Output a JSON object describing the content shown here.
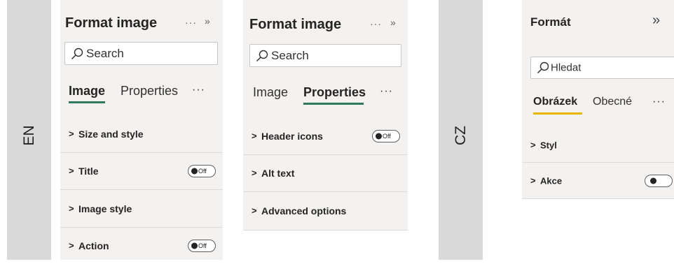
{
  "languages": {
    "en": "EN",
    "cz": "CZ"
  },
  "panel_en_image": {
    "title": "Format image",
    "more_icon": "ellipsis-icon",
    "collapse_icon": "double-chevron-right-icon",
    "search_placeholder": "Search",
    "tabs": [
      {
        "label": "Image",
        "active": true
      },
      {
        "label": "Properties",
        "active": false
      }
    ],
    "tab_more": "···",
    "sections": [
      {
        "label": "Size and style",
        "toggle": null
      },
      {
        "label": "Title",
        "toggle": "Off"
      },
      {
        "label": "Image style",
        "toggle": null
      },
      {
        "label": "Action",
        "toggle": "Off"
      }
    ]
  },
  "panel_en_properties": {
    "title": "Format image",
    "search_placeholder": "Search",
    "tabs": [
      {
        "label": "Image",
        "active": false
      },
      {
        "label": "Properties",
        "active": true
      }
    ],
    "tab_more": "···",
    "sections": [
      {
        "label": "Header icons",
        "toggle": "Off"
      },
      {
        "label": "Alt text",
        "toggle": null
      },
      {
        "label": "Advanced options",
        "toggle": null
      }
    ]
  },
  "panel_cz": {
    "title": "Formát",
    "search_placeholder": "Hledat",
    "tabs": [
      {
        "label": "Obrázek",
        "active": true
      },
      {
        "label": "Obecné",
        "active": false
      }
    ],
    "tab_more": "···",
    "sections": [
      {
        "label": "Styl",
        "toggle": null
      },
      {
        "label": "Akce",
        "toggle": ""
      }
    ]
  },
  "colors": {
    "tab_underline_en": "#2f7a5f",
    "tab_underline_cz": "#e8b400",
    "pane_bg": "#f3f2f1",
    "lang_bar": "#d9d9d9"
  }
}
